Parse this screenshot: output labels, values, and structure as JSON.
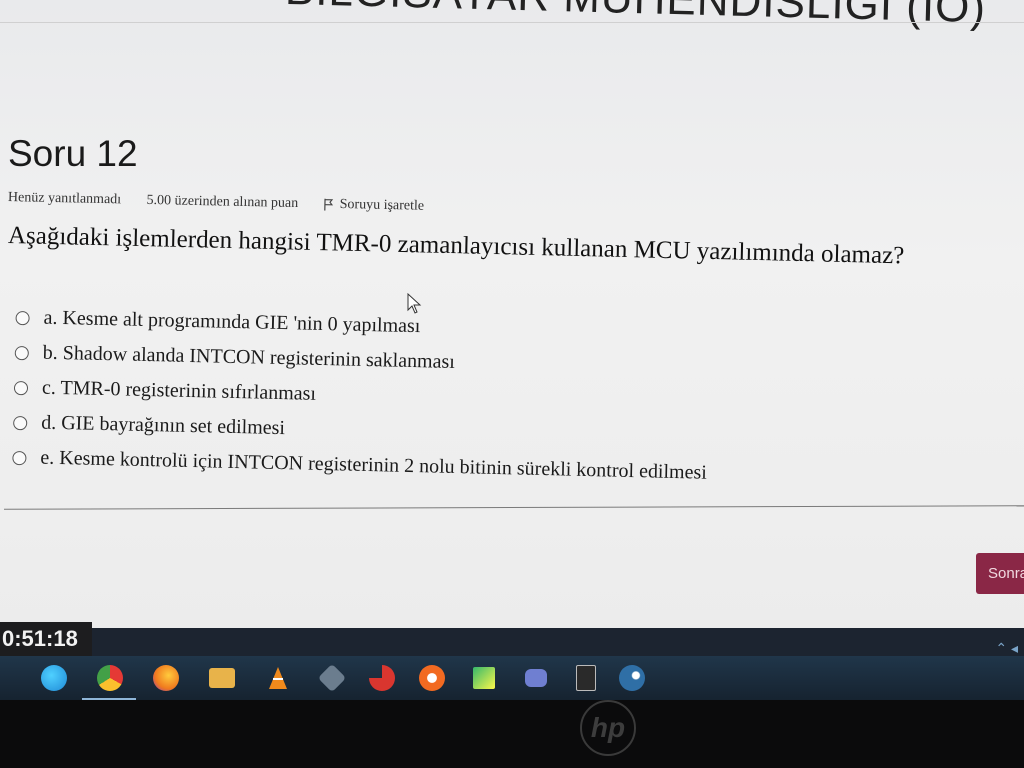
{
  "course_header": "BILGISAYAR MÜHENDİSLİĞİ (İÖ)",
  "question": {
    "title": "Soru 12",
    "status": "Henüz yanıtlanmadı",
    "points": "5.00 üzerinden alınan puan",
    "flag_label": "Soruyu işaretle",
    "text": "Aşağıdaki işlemlerden hangisi TMR-0 zamanlayıcısı kullanan MCU yazılımında olamaz?",
    "options": [
      {
        "label": "a. Kesme alt programında GIE 'nin 0 yapılması"
      },
      {
        "label": "b. Shadow alanda INTCON registerinin saklanması"
      },
      {
        "label": "c. TMR-0 registerinin sıfırlanması"
      },
      {
        "label": "d. GIE bayrağının set edilmesi"
      },
      {
        "label": "e. Kesme kontrolü için INTCON registerinin 2 nolu bitinin sürekli kontrol edilmesi"
      }
    ]
  },
  "nav": {
    "next_label": "Sonra"
  },
  "timer": {
    "value": "0:51:18"
  },
  "taskbar": {
    "icons": [
      "edge-icon",
      "chrome-icon",
      "firefox-icon",
      "file-explorer-icon",
      "vlc-icon",
      "git-icon",
      "ccleaner-icon",
      "origin-icon",
      "pycharm-icon",
      "discord-icon",
      "epic-games-icon",
      "steam-icon"
    ],
    "colors": [
      "#1f8ad6",
      "#e3a21a",
      "#f07a1e",
      "#e8b34a",
      "#f08a1c",
      "#6b7d8e",
      "#d9362f",
      "#f26a21",
      "#35b86b",
      "#6f7fd1",
      "#2a2a2a",
      "#2f6fa6"
    ]
  },
  "monitor": {
    "brand": "hp"
  },
  "colors": {
    "accent": "#8a2746",
    "text": "#111111",
    "background": "#efefef"
  }
}
